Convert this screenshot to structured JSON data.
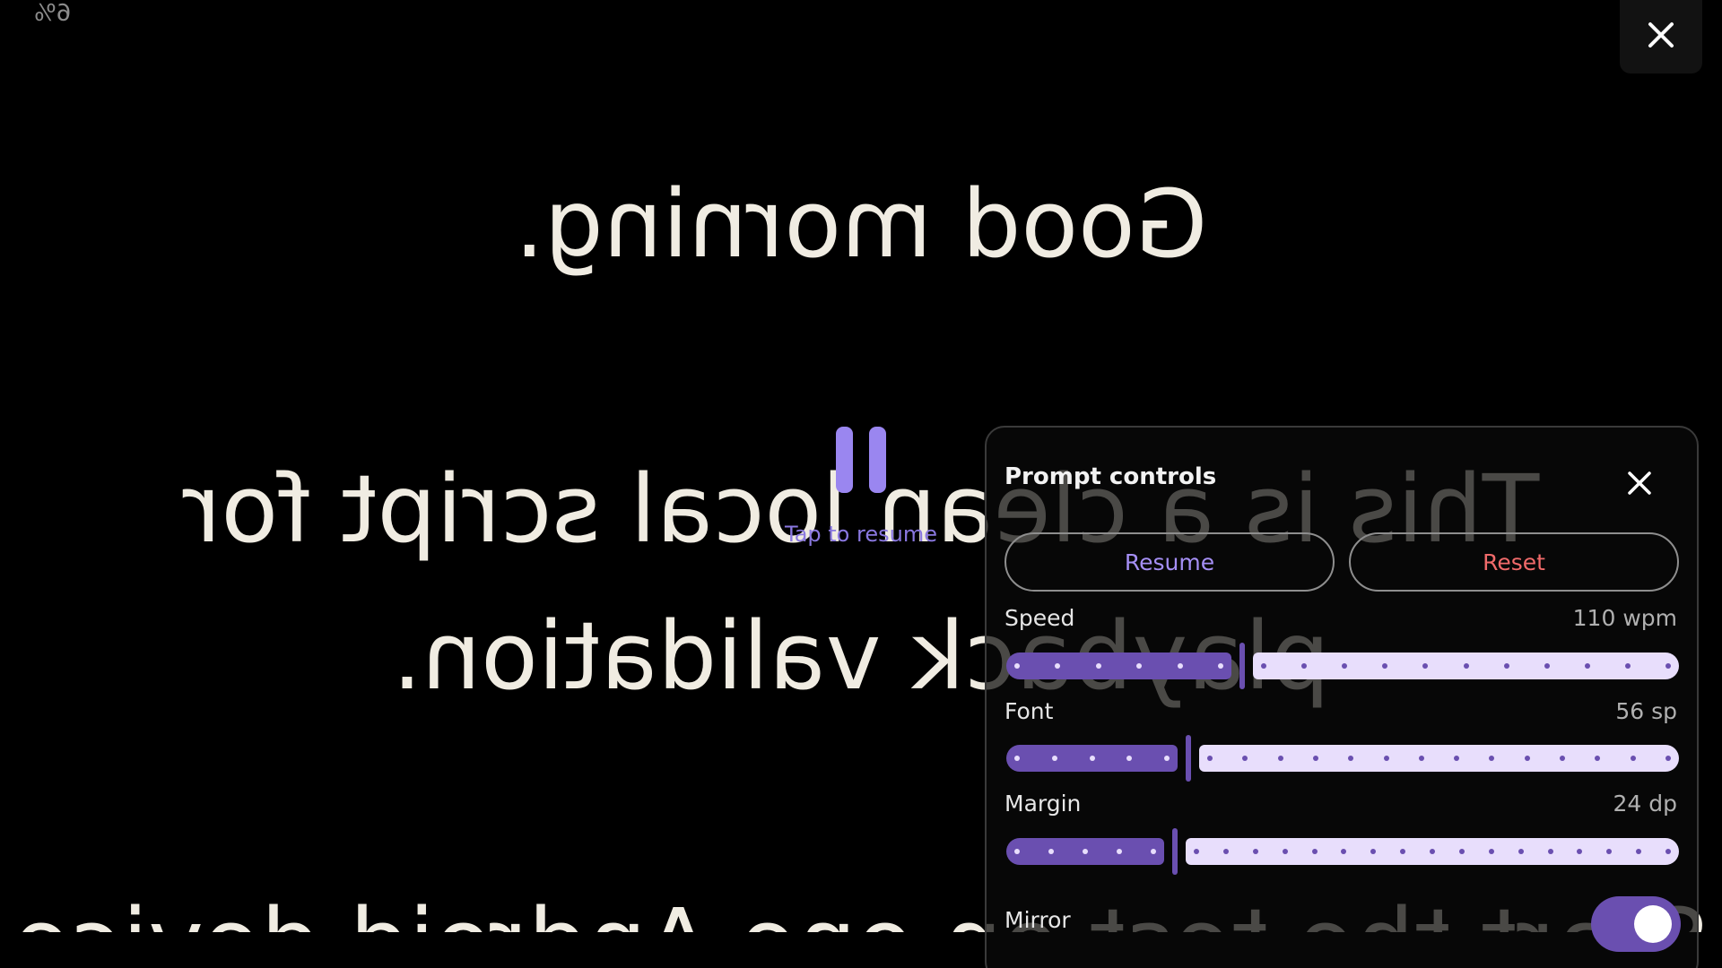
{
  "progress_readout": "6%",
  "script": {
    "lines": [
      "Good morning.",
      "This is a clean local script for",
      "playback validation.",
      "Start the test on one Android device"
    ]
  },
  "pause_overlay": {
    "hint": "Tap to resume"
  },
  "panel": {
    "title": "Prompt controls",
    "resume_label": "Resume",
    "reset_label": "Reset",
    "speed": {
      "label": "Speed",
      "value_text": "110 wpm",
      "level": 0.35
    },
    "font": {
      "label": "Font",
      "value_text": "56 sp",
      "level": 0.27
    },
    "margin": {
      "label": "Margin",
      "value_text": "24 dp",
      "level": 0.25
    },
    "mirror": {
      "label": "Mirror",
      "on": true
    }
  },
  "colors": {
    "accent": "#6a4fb0",
    "accent_light": "#e8defc",
    "reset": "#f06a6a",
    "text": "#f0ece2"
  },
  "icons": {
    "close_main": "close-icon",
    "panel_close": "close-icon",
    "pause": "pause-icon"
  }
}
